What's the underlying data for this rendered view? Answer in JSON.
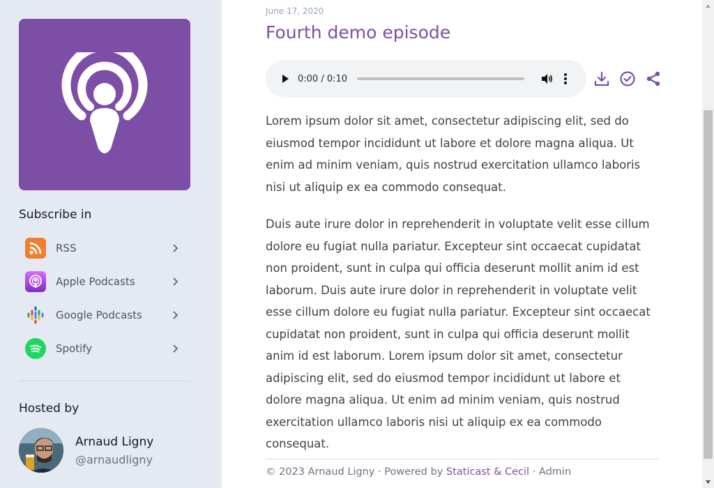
{
  "sidebar": {
    "cover_icon": "podcast-icon",
    "subscribe_title": "Subscribe in",
    "subscriptions": [
      {
        "label": "RSS",
        "icon": "rss-icon",
        "color": "#ee802f"
      },
      {
        "label": "Apple Podcasts",
        "icon": "apple-podcasts-icon",
        "color": "#9933cc"
      },
      {
        "label": "Google Podcasts",
        "icon": "google-podcasts-icon",
        "color": "#4285f4"
      },
      {
        "label": "Spotify",
        "icon": "spotify-icon",
        "color": "#1ed760"
      }
    ],
    "hosted_title": "Hosted by",
    "host": {
      "name": "Arnaud Ligny",
      "handle": "@arnaudligny"
    }
  },
  "episode": {
    "date": "June 17, 2020",
    "title": "Fourth demo episode",
    "player": {
      "time": "0:00 / 0:10",
      "progress": 0
    },
    "actions": [
      "download-icon",
      "check-circle-icon",
      "share-icon"
    ],
    "paragraphs": [
      "Lorem ipsum dolor sit amet, consectetur adipiscing elit, sed do eiusmod tempor incididunt ut labore et dolore magna aliqua. Ut enim ad minim veniam, quis nostrud exercitation ullamco laboris nisi ut aliquip ex ea commodo consequat.",
      "Duis aute irure dolor in reprehenderit in voluptate velit esse cillum dolore eu fugiat nulla pariatur. Excepteur sint occaecat cupidatat non proident, sunt in culpa qui officia deserunt mollit anim id est laborum. Duis aute irure dolor in reprehenderit in voluptate velit esse cillum dolore eu fugiat nulla pariatur. Excepteur sint occaecat cupidatat non proident, sunt in culpa qui officia deserunt mollit anim id est laborum. Lorem ipsum dolor sit amet, consectetur adipiscing elit, sed do eiusmod tempor incididunt ut labore et dolore magna aliqua. Ut enim ad minim veniam, quis nostrud exercitation ullamco laboris nisi ut aliquip ex ea commodo consequat."
    ]
  },
  "footer": {
    "copyright": "© 2023 Arnaud Ligny · Powered by ",
    "staticast": "Staticast",
    "amp": " & ",
    "cecil": "Cecil",
    "sep": " · ",
    "admin": "Admin"
  },
  "colors": {
    "accent": "#7d4ea6",
    "sidebar_bg": "#e5e9f2"
  }
}
